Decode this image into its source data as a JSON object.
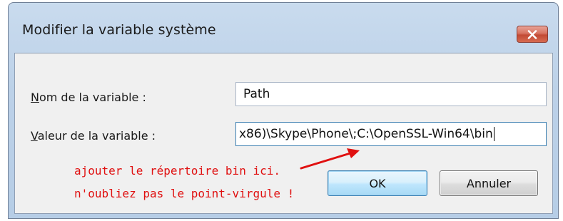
{
  "window": {
    "title": "Modifier la variable système",
    "close_icon": "close-icon"
  },
  "form": {
    "name_label_accel": "N",
    "name_label_rest": "om de la variable :",
    "name_value": "Path",
    "value_label_accel": "V",
    "value_label_rest": "aleur de la variable :",
    "value_value": "x86)\\Skype\\Phone\\;C:\\OpenSSL-Win64\\bin"
  },
  "buttons": {
    "ok_label": "OK",
    "cancel_label": "Annuler"
  },
  "annotation": {
    "line1": "ajouter le répertoire bin ici.",
    "line2": "n'oubliez pas le point-virgule !",
    "color": "#e01010"
  },
  "colors": {
    "frame": "#bcd1e8",
    "client": "#f0f0f0",
    "close_button": "#c24a34",
    "ok_border": "#3c7fb1"
  }
}
